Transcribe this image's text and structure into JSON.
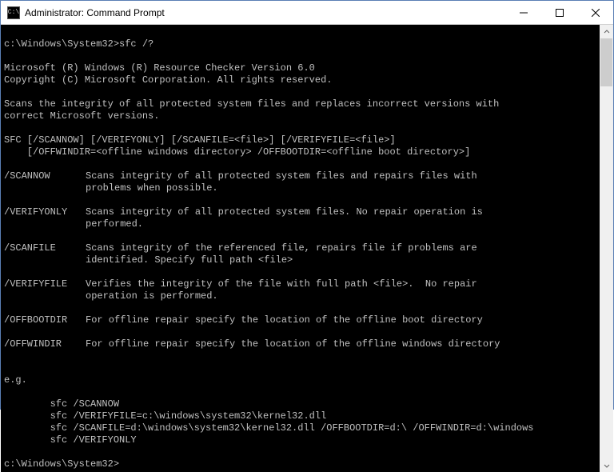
{
  "window": {
    "title": "Administrator: Command Prompt",
    "icon_label": "cmd-icon"
  },
  "prompt1": "c:\\Windows\\System32>sfc /?",
  "header1": "Microsoft (R) Windows (R) Resource Checker Version 6.0",
  "header2": "Copyright (C) Microsoft Corporation. All rights reserved.",
  "desc": "Scans the integrity of all protected system files and replaces incorrect versions with\ncorrect Microsoft versions.",
  "usage1": "SFC [/SCANNOW] [/VERIFYONLY] [/SCANFILE=<file>] [/VERIFYFILE=<file>]",
  "usage2": "    [/OFFWINDIR=<offline windows directory> /OFFBOOTDIR=<offline boot directory>]",
  "options": [
    {
      "name": "/SCANNOW",
      "desc": "Scans integrity of all protected system files and repairs files with\nproblems when possible."
    },
    {
      "name": "/VERIFYONLY",
      "desc": "Scans integrity of all protected system files. No repair operation is\nperformed."
    },
    {
      "name": "/SCANFILE",
      "desc": "Scans integrity of the referenced file, repairs file if problems are\nidentified. Specify full path <file>"
    },
    {
      "name": "/VERIFYFILE",
      "desc": "Verifies the integrity of the file with full path <file>.  No repair\noperation is performed."
    },
    {
      "name": "/OFFBOOTDIR",
      "desc": "For offline repair specify the location of the offline boot directory"
    },
    {
      "name": "/OFFWINDIR",
      "desc": "For offline repair specify the location of the offline windows directory"
    }
  ],
  "eg_label": "e.g.",
  "examples": [
    "        sfc /SCANNOW",
    "        sfc /VERIFYFILE=c:\\windows\\system32\\kernel32.dll",
    "        sfc /SCANFILE=d:\\windows\\system32\\kernel32.dll /OFFBOOTDIR=d:\\ /OFFWINDIR=d:\\windows",
    "        sfc /VERIFYONLY"
  ],
  "prompt2": "c:\\Windows\\System32>",
  "colors": {
    "fg": "#c0c0c0",
    "bg": "#000000"
  }
}
